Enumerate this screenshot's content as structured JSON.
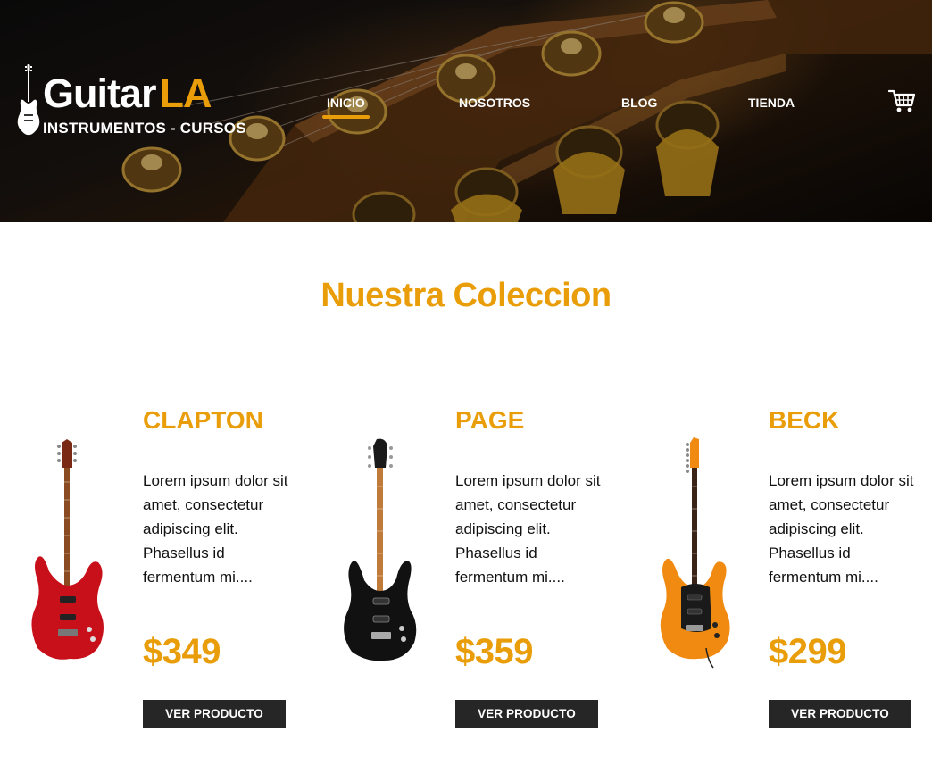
{
  "header": {
    "brand_primary": "Guitar",
    "brand_accent": "LA",
    "tagline": "INSTRUMENTOS - CURSOS",
    "nav": [
      {
        "label": "INICIO",
        "active": true
      },
      {
        "label": "NOSOTROS",
        "active": false
      },
      {
        "label": "BLOG",
        "active": false
      },
      {
        "label": "TIENDA",
        "active": false
      }
    ],
    "cart_icon": "shopping-cart-icon"
  },
  "main": {
    "title": "Nuestra Coleccion",
    "products": [
      {
        "name": "CLAPTON",
        "description": "Lorem ipsum dolor sit amet, consectetur adipiscing elit. Phasellus id fermentum mi....",
        "price": "$349",
        "button_label": "VER PRODUCTO",
        "guitar_color": "#c8101a"
      },
      {
        "name": "PAGE",
        "description": "Lorem ipsum dolor sit amet, consectetur adipiscing elit. Phasellus id fermentum mi....",
        "price": "$359",
        "button_label": "VER PRODUCTO",
        "guitar_color": "#111111"
      },
      {
        "name": "BECK",
        "description": "Lorem ipsum dolor sit amet, consectetur adipiscing elit. Phasellus id fermentum mi....",
        "price": "$299",
        "button_label": "VER PRODUCTO",
        "guitar_color": "#f08a10"
      }
    ]
  },
  "colors": {
    "accent": "#e99d09",
    "button_bg": "#262626",
    "text": "#111111"
  }
}
